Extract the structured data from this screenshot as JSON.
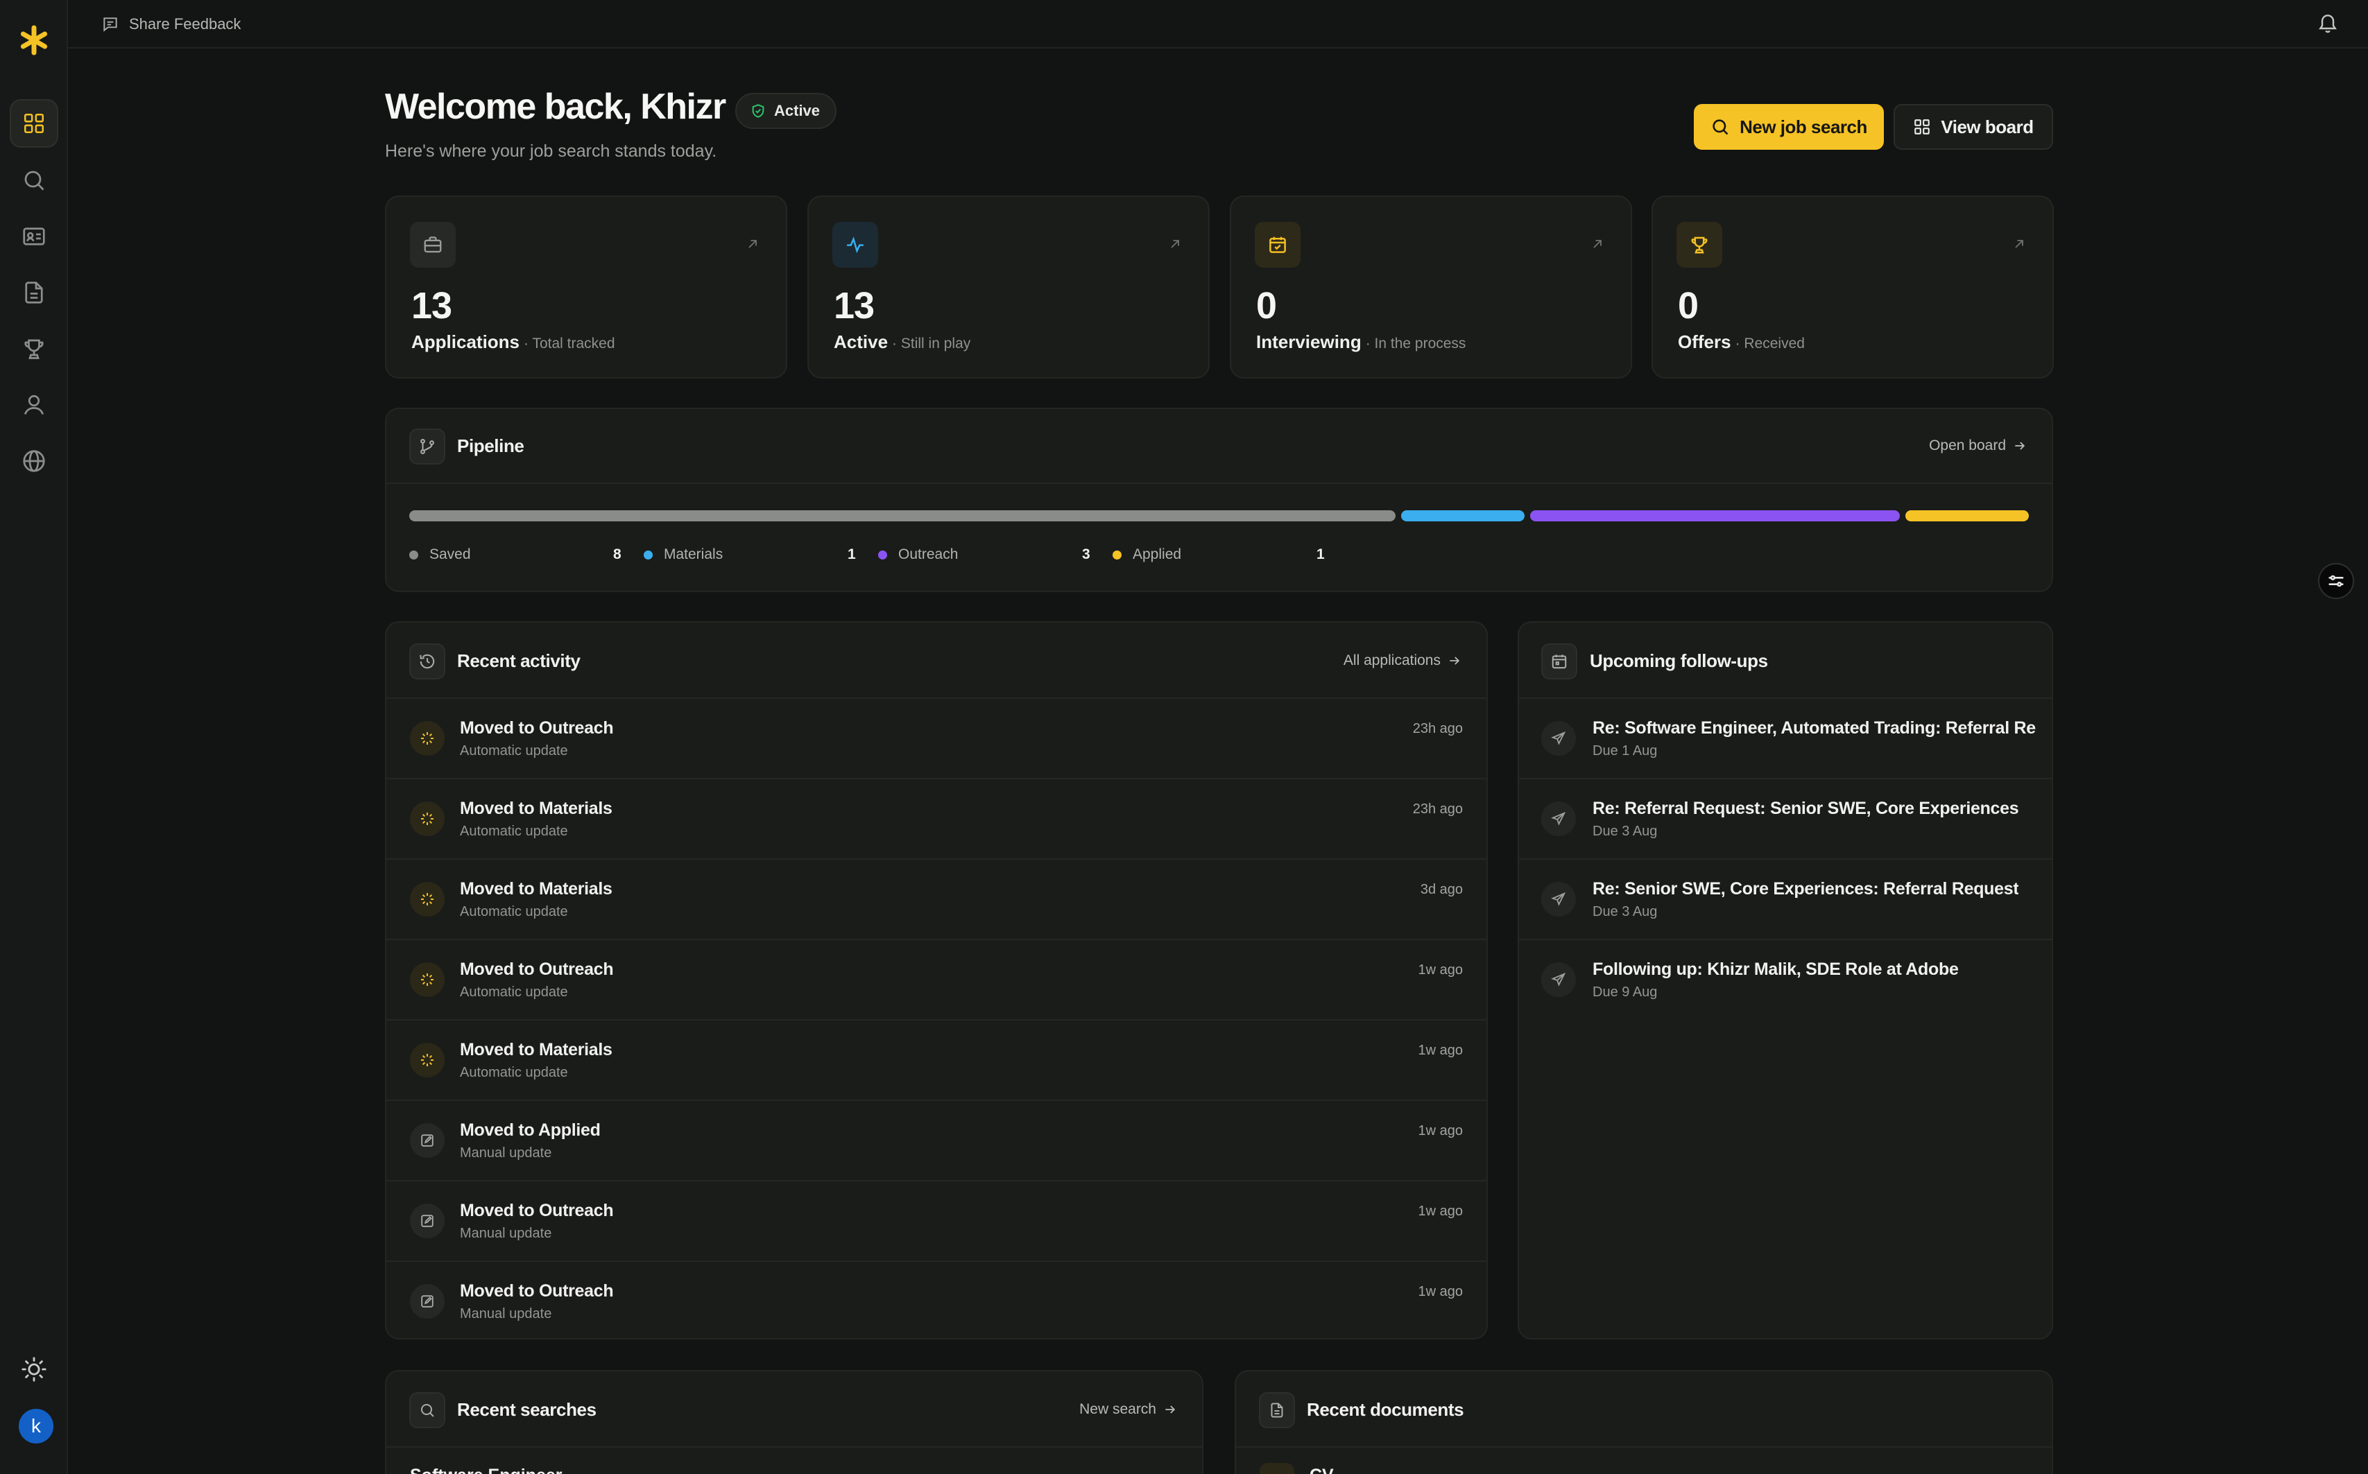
{
  "topbar": {
    "feedback_label": "Share Feedback"
  },
  "header": {
    "title": "Welcome back, Khizr",
    "status": "Active",
    "subtitle": "Here's where your job search stands today.",
    "new_search_label": "New job search",
    "view_board_label": "View board"
  },
  "stats": [
    {
      "value": "13",
      "label": "Applications",
      "sub": "· Total tracked",
      "icon": "briefcase-icon",
      "color": "#9a9d99"
    },
    {
      "value": "13",
      "label": "Active",
      "sub": "· Still in play",
      "icon": "activity-icon",
      "color": "#39b0f0"
    },
    {
      "value": "0",
      "label": "Interviewing",
      "sub": "· In the process",
      "icon": "calendar-check-icon",
      "color": "#f3c024"
    },
    {
      "value": "0",
      "label": "Offers",
      "sub": "· Received",
      "icon": "trophy-icon",
      "color": "#f3c024"
    }
  ],
  "pipeline": {
    "title": "Pipeline",
    "link": "Open board",
    "stages": [
      {
        "name": "Saved",
        "count": 8,
        "color": "#8a8c89"
      },
      {
        "name": "Materials",
        "count": 1,
        "color": "#3aaeee"
      },
      {
        "name": "Outreach",
        "count": 3,
        "color": "#8b53f2"
      },
      {
        "name": "Applied",
        "count": 1,
        "color": "#f5c325"
      }
    ]
  },
  "activity": {
    "title": "Recent activity",
    "link": "All applications",
    "items": [
      {
        "title": "Moved to Outreach",
        "sub": "Automatic update",
        "time": "23h ago",
        "kind": "auto"
      },
      {
        "title": "Moved to Materials",
        "sub": "Automatic update",
        "time": "23h ago",
        "kind": "auto"
      },
      {
        "title": "Moved to Materials",
        "sub": "Automatic update",
        "time": "3d ago",
        "kind": "auto"
      },
      {
        "title": "Moved to Outreach",
        "sub": "Automatic update",
        "time": "1w ago",
        "kind": "auto"
      },
      {
        "title": "Moved to Materials",
        "sub": "Automatic update",
        "time": "1w ago",
        "kind": "auto"
      },
      {
        "title": "Moved to Applied",
        "sub": "Manual update",
        "time": "1w ago",
        "kind": "manual"
      },
      {
        "title": "Moved to Outreach",
        "sub": "Manual update",
        "time": "1w ago",
        "kind": "manual"
      },
      {
        "title": "Moved to Outreach",
        "sub": "Manual update",
        "time": "1w ago",
        "kind": "manual"
      }
    ]
  },
  "followups": {
    "title": "Upcoming follow-ups",
    "items": [
      {
        "title": "Re: Software Engineer, Automated Trading: Referral Req...",
        "due": "Due 1 Aug"
      },
      {
        "title": "Re: Referral Request: Senior SWE, Core Experiences",
        "due": "Due 3 Aug"
      },
      {
        "title": "Re: Senior SWE, Core Experiences: Referral Request",
        "due": "Due 3 Aug"
      },
      {
        "title": "Following up: Khizr Malik, SDE Role at Adobe",
        "due": "Due 9 Aug"
      }
    ]
  },
  "searches": {
    "title": "Recent searches",
    "link": "New search",
    "first_item": "Software Engineer"
  },
  "documents": {
    "title": "Recent documents",
    "first_item": "CV"
  },
  "user": {
    "avatar_letter": "k"
  }
}
